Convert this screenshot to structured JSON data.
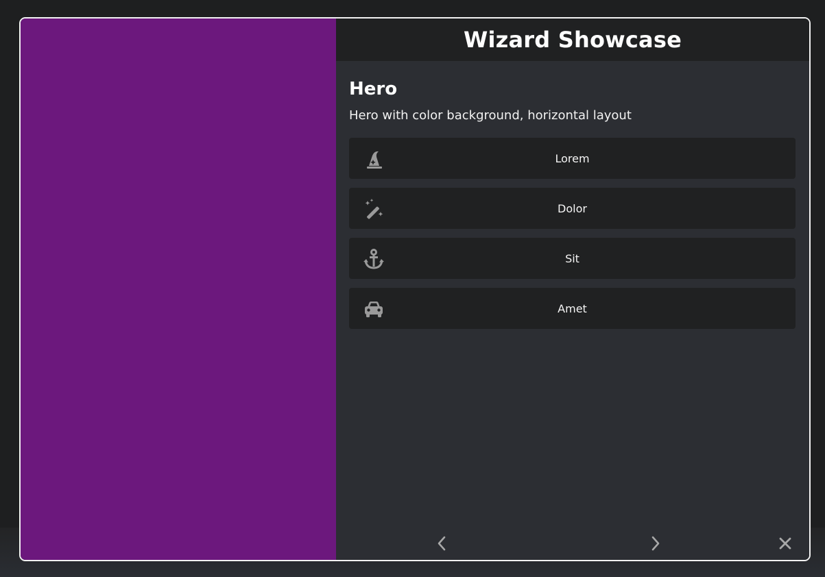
{
  "dialog": {
    "title": "Wizard Showcase",
    "hero_color": "#6c187d"
  },
  "section": {
    "title": "Hero",
    "subtitle": "Hero with color background, horizontal layout"
  },
  "options": [
    {
      "label": "Lorem",
      "icon": "wizard-hat-icon"
    },
    {
      "label": "Dolor",
      "icon": "magic-wand-icon"
    },
    {
      "label": "Sit",
      "icon": "anchor-icon"
    },
    {
      "label": "Amet",
      "icon": "car-icon"
    }
  ],
  "footer": {
    "prev_icon": "chevron-left-icon",
    "next_icon": "chevron-right-icon",
    "close_icon": "close-icon"
  }
}
